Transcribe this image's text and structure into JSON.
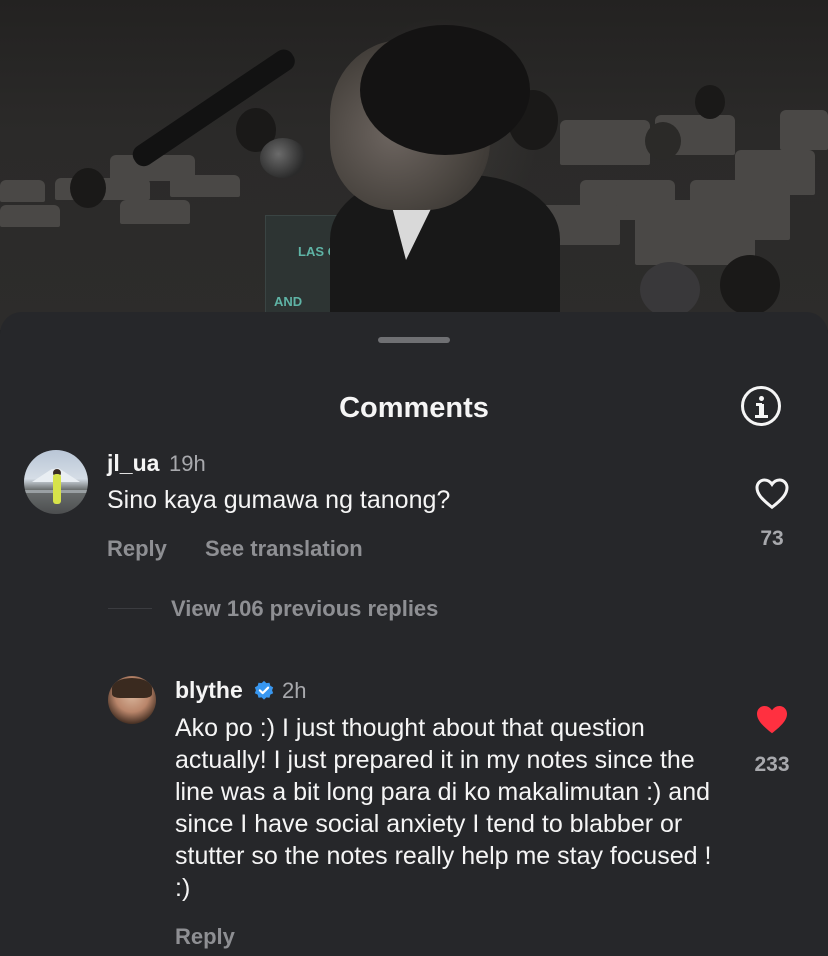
{
  "video": {
    "sign_text_1": "LAS   QUE",
    "sign_text_2": "AND"
  },
  "sheet": {
    "title": "Comments",
    "info_icon": "info-circle-icon"
  },
  "comments": [
    {
      "username": "jl_ua",
      "time": "19h",
      "text": "Sino kaya gumawa ng tanong?",
      "reply_label": "Reply",
      "translate_label": "See translation",
      "likes": "73",
      "liked": false
    }
  ],
  "view_replies_label": "View 106 previous replies",
  "reply": {
    "username": "blythe",
    "verified": true,
    "time": "2h",
    "text": "Ako po :) I just thought about that question actually! I just prepared it in my notes since the line was a bit long para di ko makalimutan :) and since I have social anxiety I tend to blabber or stutter so the notes really help me stay focused ! :)",
    "reply_label": "Reply",
    "likes": "233",
    "liked": true
  },
  "colors": {
    "sheet_bg": "#26272a",
    "secondary_text": "#a8a9ad",
    "verified_blue": "#3897f0",
    "liked_red": "#ff3040"
  }
}
